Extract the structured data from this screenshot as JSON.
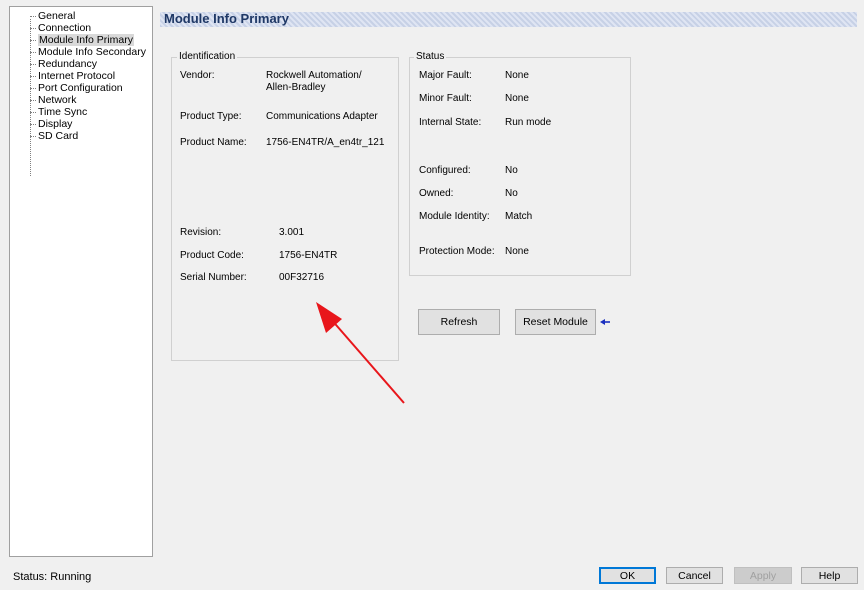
{
  "tree": {
    "items": [
      "General",
      "Connection",
      "Module Info Primary",
      "Module Info Secondary",
      "Redundancy",
      "Internet Protocol",
      "Port Configuration",
      "Network",
      "Time Sync",
      "Display",
      "SD Card"
    ],
    "selected": "Module Info Primary"
  },
  "header": {
    "title": "Module Info Primary"
  },
  "identification": {
    "title": "Identification",
    "vendor_label": "Vendor:",
    "vendor_value_line1": "Rockwell Automation/",
    "vendor_value_line2": "Allen-Bradley",
    "product_type_label": "Product Type:",
    "product_type_value": "Communications Adapter",
    "product_name_label": "Product Name:",
    "product_name_value": "1756-EN4TR/A_en4tr_121",
    "revision_label": "Revision:",
    "revision_value": "3.001",
    "product_code_label": "Product Code:",
    "product_code_value": "1756-EN4TR",
    "serial_number_label": "Serial Number:",
    "serial_number_value": "00F32716"
  },
  "status": {
    "title": "Status",
    "major_fault_label": "Major Fault:",
    "major_fault_value": "None",
    "minor_fault_label": "Minor Fault:",
    "minor_fault_value": "None",
    "internal_state_label": "Internal State:",
    "internal_state_value": "Run mode",
    "configured_label": "Configured:",
    "configured_value": "No",
    "owned_label": "Owned:",
    "owned_value": "No",
    "module_identity_label": "Module Identity:",
    "module_identity_value": "Match",
    "protection_mode_label": "Protection Mode:",
    "protection_mode_value": "None"
  },
  "actions": {
    "refresh_label": "Refresh",
    "reset_module_label": "Reset Module"
  },
  "footer": {
    "status_text": "Status:  Running",
    "ok_label": "OK",
    "cancel_label": "Cancel",
    "apply_label": "Apply",
    "help_label": "Help"
  },
  "colors": {
    "annotation_arrow": "#e8161b",
    "pointer_arrow": "#1a2fbf",
    "header_title": "#1f3866"
  }
}
